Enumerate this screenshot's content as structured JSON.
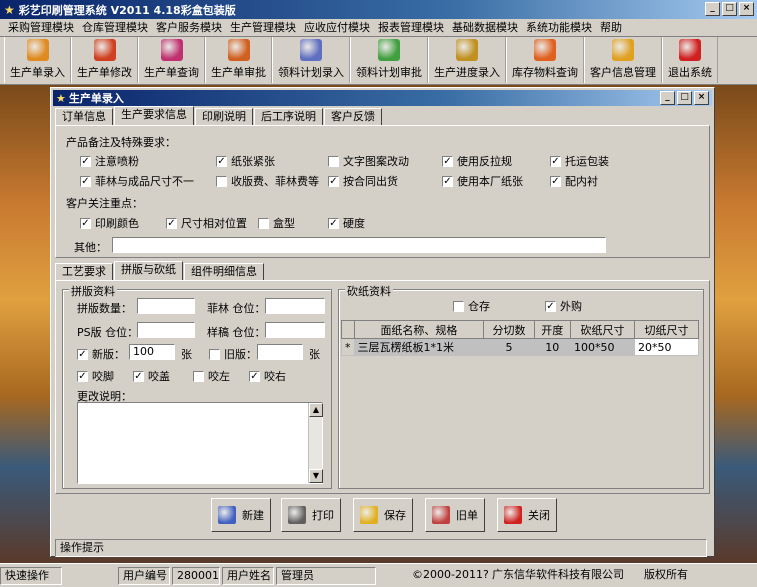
{
  "app": {
    "title": "彩艺印刷管理系统  V2011 4.18彩盒包装版"
  },
  "menu": [
    "采购管理模块",
    "仓库管理模块",
    "客户服务模块",
    "生产管理模块",
    "应收应付模块",
    "报表管理模块",
    "基础数据模块",
    "系统功能模块",
    "帮助"
  ],
  "toolbar": [
    {
      "label": "生产单录入",
      "icon": "box-icon",
      "color": "#e08a20"
    },
    {
      "label": "生产单修改",
      "icon": "boxes-icon",
      "color": "#d04020"
    },
    {
      "label": "生产单查询",
      "icon": "search-box-icon",
      "color": "#c03070"
    },
    {
      "label": "生产单审批",
      "icon": "approve-icon",
      "color": "#d06020"
    },
    {
      "label": "领料计划录入",
      "icon": "stack-icon",
      "color": "#6070c0"
    },
    {
      "label": "领料计划审批",
      "icon": "cubes-icon",
      "color": "#40a040"
    },
    {
      "label": "生产进度录入",
      "icon": "progress-icon",
      "color": "#c09020"
    },
    {
      "label": "库存物料查询",
      "icon": "inventory-icon",
      "color": "#e06020"
    },
    {
      "label": "客户信息管理",
      "icon": "customer-icon",
      "color": "#e0a020"
    },
    {
      "label": "退出系统",
      "icon": "exit-icon",
      "color": "#d02020"
    }
  ],
  "child": {
    "title": "生产单录入"
  },
  "tabs": [
    "订单信息",
    "生产要求信息",
    "印刷说明",
    "后工序说明",
    "客户反馈"
  ],
  "requirements": {
    "heading": "产品备注及特殊要求：",
    "row1": [
      {
        "label": "注意喷粉",
        "checked": true
      },
      {
        "label": "纸张紧张",
        "checked": true
      },
      {
        "label": "文字图案改动",
        "checked": false
      },
      {
        "label": "使用反拉规",
        "checked": true
      },
      {
        "label": "托运包装",
        "checked": true
      }
    ],
    "row2": [
      {
        "label": "菲林与成品尺寸不一",
        "checked": true
      },
      {
        "label": "收版费、菲林费等",
        "checked": false
      },
      {
        "label": "按合同出货",
        "checked": true
      },
      {
        "label": "使用本厂纸张",
        "checked": true
      },
      {
        "label": "配内衬",
        "checked": true
      }
    ],
    "focus_heading": "客户关注重点：",
    "focus": [
      {
        "label": "印刷颜色",
        "checked": true
      },
      {
        "label": "尺寸相对位置",
        "checked": true
      },
      {
        "label": "盒型",
        "checked": false
      },
      {
        "label": "硬度",
        "checked": true
      }
    ],
    "other_label": "其他："
  },
  "subtabs": [
    "工艺要求",
    "拼版与砍纸",
    "组件明细信息"
  ],
  "pinban": {
    "title": "拼版资料",
    "count_label": "拼版数量：",
    "film_label": "菲林 仓位：",
    "ps_label": "PS版 仓位：",
    "sample_label": "样稿 仓位：",
    "new_label": "新版：",
    "new_value": "100",
    "unit": "张",
    "old_label": "旧版：",
    "new_checked": true,
    "old_checked": false,
    "bite": [
      {
        "label": "咬脚",
        "checked": true
      },
      {
        "label": "咬盖",
        "checked": true
      },
      {
        "label": "咬左",
        "checked": false
      },
      {
        "label": "咬右",
        "checked": true
      }
    ],
    "change_label": "更改说明："
  },
  "kanzhi": {
    "title": "砍纸资料",
    "stock_label": "仓存",
    "stock_checked": false,
    "buy_label": "外购",
    "buy_checked": true,
    "columns": [
      "面纸名称、规格",
      "分切数",
      "开度",
      "砍纸尺寸",
      "切纸尺寸"
    ],
    "rows": [
      {
        "marker": "*",
        "name": "三层瓦楞纸板1*1米",
        "cuts": "5",
        "open": "10",
        "cut_size": "100*50",
        "trim_size": "20*50"
      }
    ]
  },
  "buttons": [
    {
      "label": "新建",
      "icon": "new-doc-icon",
      "color": "#4060c0"
    },
    {
      "label": "打印",
      "icon": "printer-icon",
      "color": "#606060"
    },
    {
      "label": "保存",
      "icon": "save-icon",
      "color": "#e0b020"
    },
    {
      "label": "旧单",
      "icon": "old-order-icon",
      "color": "#c04040"
    },
    {
      "label": "关闭",
      "icon": "close-icon",
      "color": "#d02020"
    }
  ],
  "child_status": "操作提示",
  "status": {
    "quick": "快速操作",
    "user_no_label": "用户编号",
    "user_no": "280001",
    "user_name_label": "用户姓名",
    "user_name": "管理员",
    "copyright": "©2000-2011?",
    "company": "广东信华软件科技有限公司",
    "rights": "版权所有"
  }
}
